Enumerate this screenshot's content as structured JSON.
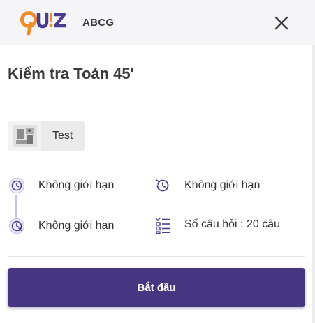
{
  "header": {
    "logo_text": "QUIZ",
    "org_name": "ABCG",
    "close_icon": "close-icon"
  },
  "quiz": {
    "title": "Kiểm tra Toán 45'",
    "tag": {
      "label": "Test",
      "thumbnail_icon": "thumbnail-icon"
    }
  },
  "info": {
    "start_time": {
      "icon": "clock-start-icon",
      "text": "Không giới hạn"
    },
    "end_time": {
      "icon": "clock-end-icon",
      "text": "Không giới hạn"
    },
    "duration": {
      "icon": "history-icon",
      "text": "Không giới hạn"
    },
    "question_count": {
      "icon": "list-icon",
      "text": "Số câu hỏi : 20 câu"
    }
  },
  "actions": {
    "start_label": "Bắt đầu"
  },
  "colors": {
    "primary": "#463682",
    "logo_orange": "#f28c28",
    "logo_purple": "#4a3b8c",
    "timeline": "#c9c2ef"
  }
}
